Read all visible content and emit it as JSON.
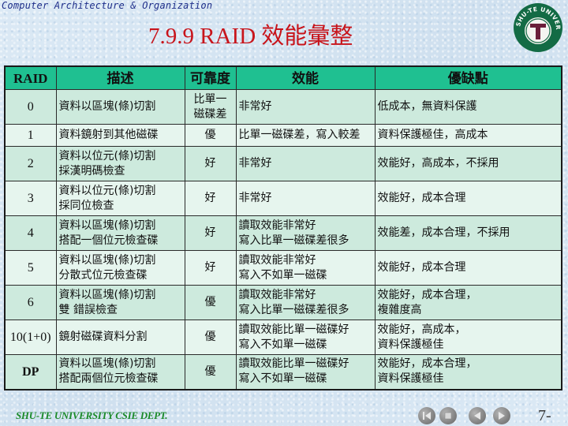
{
  "header": {
    "course_title": "Computer Architecture & Organization",
    "slide_title": "7.9.9 RAID 效能彙整",
    "logo_text": "SHU-TE UNIVERSITY",
    "logo_letter": "T"
  },
  "table": {
    "columns": [
      "RAID",
      "描述",
      "可靠度",
      "效能",
      "優缺點"
    ],
    "rows": [
      {
        "raid": "0",
        "desc": [
          "資料以區塊(條)切割"
        ],
        "reliability": [
          "比單一",
          "磁碟差"
        ],
        "performance": [
          "非常好"
        ],
        "pros_cons": [
          "低成本，無資料保護"
        ]
      },
      {
        "raid": "1",
        "desc": [
          "資料鏡射到其他磁碟"
        ],
        "reliability": [
          "優"
        ],
        "performance": [
          "比單一磁碟差，寫入較差"
        ],
        "pros_cons": [
          "資料保護極佳，高成本"
        ]
      },
      {
        "raid": "2",
        "desc": [
          "資料以位元(條)切割",
          "採漢明碼檢查"
        ],
        "reliability": [
          "好"
        ],
        "performance": [
          "非常好"
        ],
        "pros_cons": [
          "效能好，高成本，不採用"
        ]
      },
      {
        "raid": "3",
        "desc": [
          "資料以位元(條)切割",
          "採同位檢查"
        ],
        "reliability": [
          "好"
        ],
        "performance": [
          "非常好"
        ],
        "pros_cons": [
          "效能好，成本合理"
        ]
      },
      {
        "raid": "4",
        "desc": [
          "資料以區塊(條)切割",
          "搭配一個位元檢查碟"
        ],
        "reliability": [
          "好"
        ],
        "performance": [
          "讀取效能非常好",
          "寫入比單一磁碟差很多"
        ],
        "pros_cons": [
          "效能差，成本合理，不採用"
        ]
      },
      {
        "raid": "5",
        "desc": [
          "資料以區塊(條)切割",
          "分散式位元檢查碟"
        ],
        "reliability": [
          "好"
        ],
        "performance": [
          "讀取效能非常好",
          "寫入不如單一磁碟"
        ],
        "pros_cons": [
          "效能好，成本合理"
        ]
      },
      {
        "raid": "6",
        "desc": [
          "資料以區塊(條)切割",
          "雙 錯誤檢查"
        ],
        "reliability": [
          "優"
        ],
        "performance": [
          "讀取效能非常好",
          "寫入比單一磁碟差很多"
        ],
        "pros_cons": [
          "效能好，成本合理，",
          "複雜度高"
        ]
      },
      {
        "raid": "10(1+0)",
        "desc": [
          "鏡射磁碟資料分割"
        ],
        "reliability": [
          "優"
        ],
        "performance": [
          "讀取效能比單一磁碟好",
          "寫入不如單一磁碟"
        ],
        "pros_cons": [
          "效能好，高成本，",
          "資料保護極佳"
        ]
      },
      {
        "raid": "DP",
        "desc": [
          "資料以區塊(條)切割",
          "搭配兩個位元檢查碟"
        ],
        "reliability": [
          "優"
        ],
        "performance": [
          "讀取效能比單一磁碟好",
          "寫入不如單一磁碟"
        ],
        "pros_cons": [
          "效能好，成本合理，",
          "資料保護極佳"
        ]
      }
    ]
  },
  "footer": {
    "dept": "SHU-TE UNIVERSITY  CSIE DEPT.",
    "page": "7-",
    "nav": [
      {
        "name": "first-slide-button",
        "icon": "skip-back-icon"
      },
      {
        "name": "stop-button",
        "icon": "stop-icon"
      },
      {
        "name": "previous-slide-button",
        "icon": "triangle-left-icon"
      },
      {
        "name": "next-slide-button",
        "icon": "triangle-right-icon"
      }
    ]
  },
  "colors": {
    "title": "#c8141b",
    "header_row": "#1fc091",
    "row_dark": "#cdeadd",
    "row_light": "#e6f5ee",
    "footer_text": "#1b8a2a",
    "logo_green": "#136b45",
    "logo_t": "#6a1e3a"
  }
}
